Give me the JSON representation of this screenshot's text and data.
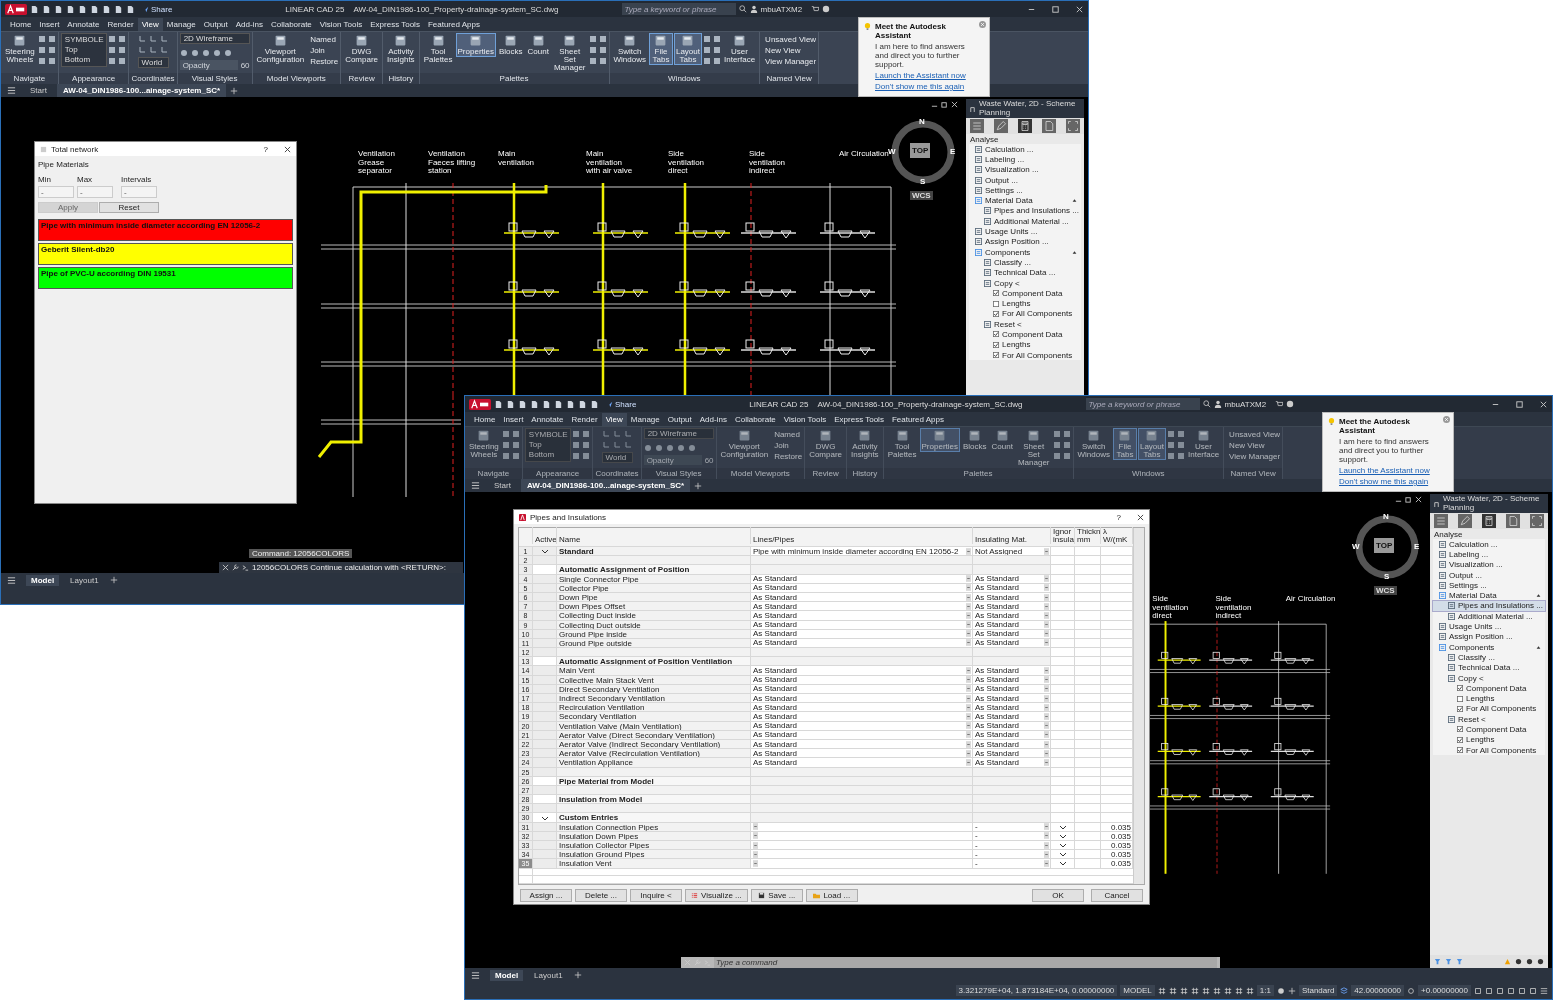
{
  "windows": [
    {
      "kind": "back",
      "app": "LINEAR CAD 25",
      "file": "AW-04_DIN1986-100_Property-drainage-system_SC.dwg",
      "share": "Share",
      "search_placeholder": "Type a keyword or phrase",
      "user": "mbuATXM2",
      "menu_tabs": [
        {
          "label": "Home",
          "selected": false
        },
        {
          "label": "Insert",
          "selected": false
        },
        {
          "label": "Annotate",
          "selected": false
        },
        {
          "label": "Render",
          "selected": false
        },
        {
          "label": "View",
          "selected": true
        },
        {
          "label": "Manage",
          "selected": false
        },
        {
          "label": "Output",
          "selected": false
        },
        {
          "label": "Add-ins",
          "selected": false
        },
        {
          "label": "Collaborate",
          "selected": false
        },
        {
          "label": "Vision Tools",
          "selected": false
        },
        {
          "label": "Express Tools",
          "selected": false
        },
        {
          "label": "Featured Apps",
          "selected": false
        }
      ],
      "ribbon": {
        "disabled": false,
        "panels": [
          {
            "title": "Navigate",
            "tools": [
              {
                "kind": "large",
                "label": "Steering Wheels",
                "selected": false
              },
              {
                "kind": "icons"
              }
            ]
          },
          {
            "title": "Appearance",
            "tools": [
              {
                "kind": "list",
                "items": [
                  "SYMBOLE",
                  "Top",
                  "Bottom"
                ]
              },
              {
                "kind": "icons"
              }
            ]
          },
          {
            "title": "Coordinates",
            "tools": [
              {
                "kind": "coords",
                "label": "World"
              }
            ]
          },
          {
            "title": "Visual Styles",
            "tools": [
              {
                "kind": "styles",
                "label": "2D Wireframe",
                "placeholder": "Opacity",
                "value": "60"
              }
            ]
          },
          {
            "title": "Model Viewports",
            "tools": [
              {
                "kind": "large",
                "label": "Viewport Configuration",
                "selected": false
              },
              {
                "kind": "stack",
                "items": [
                  "Named",
                  "Join",
                  "Restore"
                ]
              }
            ]
          },
          {
            "title": "Review",
            "tools": [
              {
                "kind": "large",
                "label": "DWG Compare",
                "selected": false
              }
            ]
          },
          {
            "title": "History",
            "tools": [
              {
                "kind": "large",
                "label": "Activity Insights",
                "selected": false
              }
            ]
          },
          {
            "title": "Palettes",
            "tools": [
              {
                "kind": "large",
                "label": "Tool Palettes",
                "selected": false
              },
              {
                "kind": "large",
                "label": "Properties",
                "selected": true
              },
              {
                "kind": "large",
                "label": "Blocks",
                "selected": false
              },
              {
                "kind": "large",
                "label": "Count",
                "selected": false
              },
              {
                "kind": "large",
                "label": "Sheet Set Manager",
                "selected": false
              },
              {
                "kind": "icons"
              }
            ]
          },
          {
            "title": "Windows",
            "tools": [
              {
                "kind": "large",
                "label": "Switch Windows",
                "selected": false
              },
              {
                "kind": "large",
                "label": "File Tabs",
                "selected": true
              },
              {
                "kind": "large",
                "label": "Layout Tabs",
                "selected": true
              },
              {
                "kind": "icons"
              },
              {
                "kind": "large",
                "label": "User Interface",
                "selected": false
              }
            ]
          },
          {
            "title": "Named View",
            "tools": [
              {
                "kind": "stack",
                "items": [
                  "Unsaved View",
                  "New View",
                  "View Manager"
                ]
              }
            ]
          }
        ]
      },
      "file_tabs": [
        {
          "label": "Start",
          "selected": false
        },
        {
          "label": "AW-04_DIN1986-100...ainage-system_SC*",
          "selected": true
        }
      ],
      "assistant": {
        "title": "Meet the Autodesk Assistant",
        "text": "I am here to find answers and direct you to further support.",
        "launch": "Launch the Assistant now",
        "dismiss": "Don't show me this again"
      },
      "drawing": {
        "labels": [
          "Ventilation Grease separator",
          "Ventilation Faeces lifting station",
          "Main ventilation",
          "Main ventilation with air valve",
          "Side ventilation direct",
          "Side ventilation indirect",
          "Air Circulation"
        ],
        "compass": {
          "north": "N",
          "south": "S",
          "east": "E",
          "west": "W",
          "top": "TOP",
          "wcs": "WCS"
        }
      },
      "palette": {
        "title": "Waste Water, 2D - Scheme Planning",
        "tabs": [
          {
            "kind": "menu",
            "selected": false
          },
          {
            "kind": "edit",
            "selected": false
          },
          {
            "kind": "calculator",
            "selected": true
          },
          {
            "kind": "document",
            "selected": false
          }
        ],
        "section": "Analyse",
        "items": [
          {
            "kind": "action",
            "label": "Calculation ...",
            "selected": false
          },
          {
            "kind": "action",
            "label": "Labeling ...",
            "selected": false
          },
          {
            "kind": "action",
            "label": "Visualization ...",
            "selected": false
          },
          {
            "kind": "action",
            "label": "Output ...",
            "selected": false
          },
          {
            "kind": "action",
            "label": "Settings ...",
            "selected": false
          },
          {
            "kind": "group",
            "label": "Material Data",
            "expanded": true,
            "children": [
              {
                "kind": "action",
                "label": "Pipes and Insulations ...",
                "selected": false
              },
              {
                "kind": "action",
                "label": "Additional Material ...",
                "selected": false
              }
            ]
          },
          {
            "kind": "action",
            "label": "Usage Units ...",
            "selected": false
          },
          {
            "kind": "action",
            "label": "Assign Position ...",
            "selected": false
          },
          {
            "kind": "group",
            "label": "Components",
            "expanded": true,
            "children": [
              {
                "kind": "action",
                "label": "Classify ...",
                "selected": false
              },
              {
                "kind": "action",
                "label": "Technical Data ...",
                "selected": false
              },
              {
                "kind": "action",
                "label": "Copy <",
                "selected": false,
                "children": [
                  {
                    "kind": "check",
                    "label": "Component Data",
                    "checked": true
                  },
                  {
                    "kind": "check",
                    "label": "Lengths",
                    "checked": false
                  },
                  {
                    "kind": "check",
                    "label": "For All Components",
                    "checked": true
                  }
                ]
              },
              {
                "kind": "action",
                "label": "Reset <",
                "selected": false,
                "children": [
                  {
                    "kind": "check",
                    "label": "Component Data",
                    "checked": true
                  },
                  {
                    "kind": "check",
                    "label": "Lengths",
                    "checked": true
                  },
                  {
                    "kind": "check",
                    "label": "For All Components",
                    "checked": true
                  }
                ]
              }
            ]
          }
        ]
      },
      "command_history": "Command: 12056COLORS",
      "command_text": "12056COLORS Continue calculation with <RETURN>:",
      "layout_tabs": [
        {
          "label": "Model",
          "selected": true
        },
        {
          "label": "Layout1",
          "selected": false
        }
      ],
      "total_network": {
        "title": "Total network",
        "help": "?",
        "heading": "Pipe Materials",
        "fields": [
          {
            "label": "Min",
            "value": "-"
          },
          {
            "label": "Max",
            "value": "-"
          },
          {
            "label": "Intervals",
            "value": "-"
          }
        ],
        "buttons": [
          {
            "label": "Apply",
            "disabled": true
          },
          {
            "label": "Reset",
            "disabled": false
          }
        ],
        "entries": [
          {
            "label": "Pipe with minimum inside diameter according EN 12056-2",
            "color": "#ff0000"
          },
          {
            "label": "Geberit Silent-db20",
            "color": "#ffff00"
          },
          {
            "label": "Pipe of PVC-U according DIN 19531",
            "color": "#00ff00"
          }
        ]
      }
    },
    {
      "kind": "front",
      "app": "LINEAR CAD 25",
      "file": "AW-04_DIN1986-100_Property-drainage-system_SC.dwg",
      "share": "Share",
      "search_placeholder": "Type a keyword or phrase",
      "user": "mbuATXM2",
      "menu_tabs": [
        {
          "label": "Home",
          "selected": false
        },
        {
          "label": "Insert",
          "selected": false
        },
        {
          "label": "Annotate",
          "selected": false
        },
        {
          "label": "Render",
          "selected": false
        },
        {
          "label": "View",
          "selected": true
        },
        {
          "label": "Manage",
          "selected": false
        },
        {
          "label": "Output",
          "selected": false
        },
        {
          "label": "Add-ins",
          "selected": false
        },
        {
          "label": "Collaborate",
          "selected": false
        },
        {
          "label": "Vision Tools",
          "selected": false
        },
        {
          "label": "Express Tools",
          "selected": false
        },
        {
          "label": "Featured Apps",
          "selected": false
        }
      ],
      "ribbon": {
        "disabled": true,
        "panels": [
          {
            "title": "Navigate",
            "tools": [
              {
                "kind": "large",
                "label": "Steering Wheels",
                "selected": false
              },
              {
                "kind": "icons"
              }
            ]
          },
          {
            "title": "Appearance",
            "tools": [
              {
                "kind": "list",
                "items": [
                  "SYMBOLE",
                  "Top",
                  "Bottom"
                ]
              },
              {
                "kind": "icons"
              }
            ]
          },
          {
            "title": "Coordinates",
            "tools": [
              {
                "kind": "coords",
                "label": "World"
              }
            ]
          },
          {
            "title": "Visual Styles",
            "tools": [
              {
                "kind": "styles",
                "label": "2D Wireframe",
                "placeholder": "Opacity",
                "value": "60"
              }
            ]
          },
          {
            "title": "Model Viewports",
            "tools": [
              {
                "kind": "large",
                "label": "Viewport Configuration",
                "selected": false
              },
              {
                "kind": "stack",
                "items": [
                  "Named",
                  "Join",
                  "Restore"
                ]
              }
            ]
          },
          {
            "title": "Review",
            "tools": [
              {
                "kind": "large",
                "label": "DWG Compare",
                "selected": false
              }
            ]
          },
          {
            "title": "History",
            "tools": [
              {
                "kind": "large",
                "label": "Activity Insights",
                "selected": false
              }
            ]
          },
          {
            "title": "Palettes",
            "tools": [
              {
                "kind": "large",
                "label": "Tool Palettes",
                "selected": false
              },
              {
                "kind": "large",
                "label": "Properties",
                "selected": true
              },
              {
                "kind": "large",
                "label": "Blocks",
                "selected": false
              },
              {
                "kind": "large",
                "label": "Count",
                "selected": false
              },
              {
                "kind": "large",
                "label": "Sheet Set Manager",
                "selected": false
              },
              {
                "kind": "icons"
              }
            ]
          },
          {
            "title": "Windows",
            "tools": [
              {
                "kind": "large",
                "label": "Switch Windows",
                "selected": false
              },
              {
                "kind": "large",
                "label": "File Tabs",
                "selected": true
              },
              {
                "kind": "large",
                "label": "Layout Tabs",
                "selected": true
              },
              {
                "kind": "icons"
              },
              {
                "kind": "large",
                "label": "User Interface",
                "selected": false
              }
            ]
          },
          {
            "title": "Named View",
            "tools": [
              {
                "kind": "stack",
                "items": [
                  "Unsaved View",
                  "New View",
                  "View Manager"
                ]
              }
            ]
          }
        ]
      },
      "file_tabs": [
        {
          "label": "Start",
          "selected": false
        },
        {
          "label": "AW-04_DIN1986-100...ainage-system_SC*",
          "selected": true
        }
      ],
      "assistant": {
        "title": "Meet the Autodesk Assistant",
        "text": "I am here to find answers and direct you to further support.",
        "launch": "Launch the Assistant now",
        "dismiss": "Don't show me this again"
      },
      "drawing": {
        "labels": [
          "Side ventilation direct",
          "Side ventilation indirect",
          "Air Circulation"
        ],
        "compass": {
          "north": "N",
          "south": "S",
          "east": "E",
          "west": "W",
          "top": "TOP",
          "wcs": "WCS"
        }
      },
      "palette": {
        "title": "Waste Water, 2D - Scheme Planning",
        "tabs": [
          {
            "kind": "menu",
            "selected": false
          },
          {
            "kind": "edit",
            "selected": false
          },
          {
            "kind": "calculator",
            "selected": true
          },
          {
            "kind": "document",
            "selected": false
          }
        ],
        "section": "Analyse",
        "items": [
          {
            "kind": "action",
            "label": "Calculation ...",
            "selected": false
          },
          {
            "kind": "action",
            "label": "Labeling ...",
            "selected": false
          },
          {
            "kind": "action",
            "label": "Visualization ...",
            "selected": false
          },
          {
            "kind": "action",
            "label": "Output ...",
            "selected": false
          },
          {
            "kind": "action",
            "label": "Settings ...",
            "selected": false
          },
          {
            "kind": "group",
            "label": "Material Data",
            "expanded": true,
            "children": [
              {
                "kind": "action",
                "label": "Pipes and Insulations ...",
                "selected": true
              },
              {
                "kind": "action",
                "label": "Additional Material ...",
                "selected": false
              }
            ]
          },
          {
            "kind": "action",
            "label": "Usage Units ...",
            "selected": false
          },
          {
            "kind": "action",
            "label": "Assign Position ...",
            "selected": false
          },
          {
            "kind": "group",
            "label": "Components",
            "expanded": true,
            "children": [
              {
                "kind": "action",
                "label": "Classify ...",
                "selected": false
              },
              {
                "kind": "action",
                "label": "Technical Data ...",
                "selected": false
              },
              {
                "kind": "action",
                "label": "Copy <",
                "selected": false,
                "children": [
                  {
                    "kind": "check",
                    "label": "Component Data",
                    "checked": true
                  },
                  {
                    "kind": "check",
                    "label": "Lengths",
                    "checked": false
                  },
                  {
                    "kind": "check",
                    "label": "For All Components",
                    "checked": true
                  }
                ]
              },
              {
                "kind": "action",
                "label": "Reset <",
                "selected": false,
                "children": [
                  {
                    "kind": "check",
                    "label": "Component Data",
                    "checked": true
                  },
                  {
                    "kind": "check",
                    "label": "Lengths",
                    "checked": true
                  },
                  {
                    "kind": "check",
                    "label": "For All Components",
                    "checked": true
                  }
                ]
              }
            ]
          }
        ]
      },
      "command_placeholder": "Type a command",
      "layout_tabs": [
        {
          "label": "Model",
          "selected": true
        },
        {
          "label": "Layout1",
          "selected": false
        }
      ],
      "status_bar": {
        "coordinates": "3.321279E+04, 1.873184E+04, 0.00000000",
        "space": "MODEL",
        "scale": "1:1",
        "style": "Standard",
        "elevation": "42.00000000",
        "offset": "+0.00000000"
      },
      "pipes_dialog": {
        "title": "Pipes and Insulations",
        "help": "?",
        "columns": [
          "Active",
          "Name",
          "Lines/Pipes",
          "Insulating Mat.",
          "Ignor insula",
          "Thickn mm",
          "λ W/(mK"
        ],
        "rows": [
          {
            "n": "1",
            "kind": "standard",
            "active": true,
            "name": "Standard",
            "lines": "Pipe with minimum inside diameter according EN 12056-2",
            "insulating": "Not Assigned",
            "ignore": false,
            "selected": false
          },
          {
            "n": "2",
            "kind": "blank",
            "active": false,
            "ignore": false,
            "selected": false
          },
          {
            "n": "3",
            "kind": "header",
            "active": false,
            "name": "Automatic Assignment of Position",
            "ignore": false,
            "selected": false
          },
          {
            "n": "4",
            "kind": "item",
            "active": false,
            "name": "Single Connector Pipe",
            "lines": "As Standard",
            "insulating": "As Standard",
            "ignore": false,
            "selected": false
          },
          {
            "n": "5",
            "kind": "item",
            "active": false,
            "name": "Collector Pipe",
            "lines": "As Standard",
            "insulating": "As Standard",
            "ignore": false,
            "selected": false
          },
          {
            "n": "6",
            "kind": "item",
            "active": false,
            "name": "Down Pipe",
            "lines": "As Standard",
            "insulating": "As Standard",
            "ignore": false,
            "selected": false
          },
          {
            "n": "7",
            "kind": "item",
            "active": false,
            "name": "Down Pipes Offset",
            "lines": "As Standard",
            "insulating": "As Standard",
            "ignore": false,
            "selected": false
          },
          {
            "n": "8",
            "kind": "item",
            "active": false,
            "name": "Collecting Duct inside",
            "lines": "As Standard",
            "insulating": "As Standard",
            "ignore": false,
            "selected": false
          },
          {
            "n": "9",
            "kind": "item",
            "active": false,
            "name": "Collecting Duct outside",
            "lines": "As Standard",
            "insulating": "As Standard",
            "ignore": false,
            "selected": false
          },
          {
            "n": "10",
            "kind": "item",
            "active": false,
            "name": "Ground Pipe inside",
            "lines": "As Standard",
            "insulating": "As Standard",
            "ignore": false,
            "selected": false
          },
          {
            "n": "11",
            "kind": "item",
            "active": false,
            "name": "Ground Pipe outside",
            "lines": "As Standard",
            "insulating": "As Standard",
            "ignore": false,
            "selected": false
          },
          {
            "n": "12",
            "kind": "blank",
            "active": false,
            "ignore": false,
            "selected": false
          },
          {
            "n": "13",
            "kind": "header",
            "active": false,
            "name": "Automatic Assignment of Position Ventilation",
            "ignore": false,
            "selected": false
          },
          {
            "n": "14",
            "kind": "item",
            "active": false,
            "name": "Main Vent",
            "lines": "As Standard",
            "insulating": "As Standard",
            "ignore": false,
            "selected": false
          },
          {
            "n": "15",
            "kind": "item",
            "active": false,
            "name": "Collective Main Stack Vent",
            "lines": "As Standard",
            "insulating": "As Standard",
            "ignore": false,
            "selected": false
          },
          {
            "n": "16",
            "kind": "item",
            "active": false,
            "name": "Direct Secondary Ventilation",
            "lines": "As Standard",
            "insulating": "As Standard",
            "ignore": false,
            "selected": false
          },
          {
            "n": "17",
            "kind": "item",
            "active": false,
            "name": "Indirect Secondary Ventilation",
            "lines": "As Standard",
            "insulating": "As Standard",
            "ignore": false,
            "selected": false
          },
          {
            "n": "18",
            "kind": "item",
            "active": false,
            "name": "Recirculation Ventilation",
            "lines": "As Standard",
            "insulating": "As Standard",
            "ignore": false,
            "selected": false
          },
          {
            "n": "19",
            "kind": "item",
            "active": false,
            "name": "Secondary Ventilation",
            "lines": "As Standard",
            "insulating": "As Standard",
            "ignore": false,
            "selected": false
          },
          {
            "n": "20",
            "kind": "item",
            "active": false,
            "name": "Ventilation Valve (Main Ventilation)",
            "lines": "As Standard",
            "insulating": "As Standard",
            "ignore": false,
            "selected": false
          },
          {
            "n": "21",
            "kind": "item",
            "active": false,
            "name": "Aerator Valve (Direct Secondary Ventilation)",
            "lines": "As Standard",
            "insulating": "As Standard",
            "ignore": false,
            "selected": false
          },
          {
            "n": "22",
            "kind": "item",
            "active": false,
            "name": "Aerator Valve (Indirect Secondary Ventilation)",
            "lines": "As Standard",
            "insulating": "As Standard",
            "ignore": false,
            "selected": false
          },
          {
            "n": "23",
            "kind": "item",
            "active": false,
            "name": "Aerator Valve (Recirculation Ventilation)",
            "lines": "As Standard",
            "insulating": "As Standard",
            "ignore": false,
            "selected": false
          },
          {
            "n": "24",
            "kind": "item",
            "active": false,
            "name": "Ventilation Appliance",
            "lines": "As Standard",
            "insulating": "As Standard",
            "ignore": false,
            "selected": false
          },
          {
            "n": "25",
            "kind": "blank",
            "active": false,
            "ignore": false,
            "selected": false
          },
          {
            "n": "26",
            "kind": "header",
            "active": false,
            "name": "Pipe Material from Model",
            "ignore": false,
            "selected": false
          },
          {
            "n": "27",
            "kind": "blank",
            "active": false,
            "ignore": false,
            "selected": false
          },
          {
            "n": "28",
            "kind": "header",
            "active": false,
            "name": "Insulation from Model",
            "ignore": false,
            "selected": false
          },
          {
            "n": "29",
            "kind": "blank",
            "active": false,
            "ignore": false,
            "selected": false
          },
          {
            "n": "30",
            "kind": "header",
            "active": true,
            "name": "Custom Entries",
            "ignore": false,
            "selected": false
          },
          {
            "n": "31",
            "kind": "item",
            "active": false,
            "name": "Insulation Connection Pipes",
            "insulating": "-",
            "ignore": true,
            "lambda": "0.035",
            "selected": false
          },
          {
            "n": "32",
            "kind": "item",
            "active": false,
            "name": "Insulation Down Pipes",
            "insulating": "-",
            "ignore": true,
            "lambda": "0.035",
            "selected": false
          },
          {
            "n": "33",
            "kind": "item",
            "active": false,
            "name": "Insulation Collector Pipes",
            "insulating": "-",
            "ignore": true,
            "lambda": "0.035",
            "selected": false
          },
          {
            "n": "34",
            "kind": "item",
            "active": false,
            "name": "Insulation Ground Pipes",
            "insulating": "-",
            "ignore": true,
            "lambda": "0.035",
            "selected": false
          },
          {
            "n": "35",
            "kind": "item",
            "active": false,
            "name": "Insulation Vent",
            "insulating": "-",
            "ignore": true,
            "lambda": "0.035",
            "selected": true
          }
        ],
        "buttons": [
          {
            "kind": "plain",
            "label": "Assign ..."
          },
          {
            "kind": "plain",
            "label": "Delete ..."
          },
          {
            "kind": "plain",
            "label": "Inquire <"
          },
          {
            "kind": "visualize",
            "label": "Visualize ..."
          },
          {
            "kind": "save",
            "label": "Save ..."
          },
          {
            "kind": "load",
            "label": "Load ..."
          }
        ],
        "actions": [
          {
            "label": "OK"
          },
          {
            "label": "Cancel"
          }
        ]
      }
    }
  ]
}
